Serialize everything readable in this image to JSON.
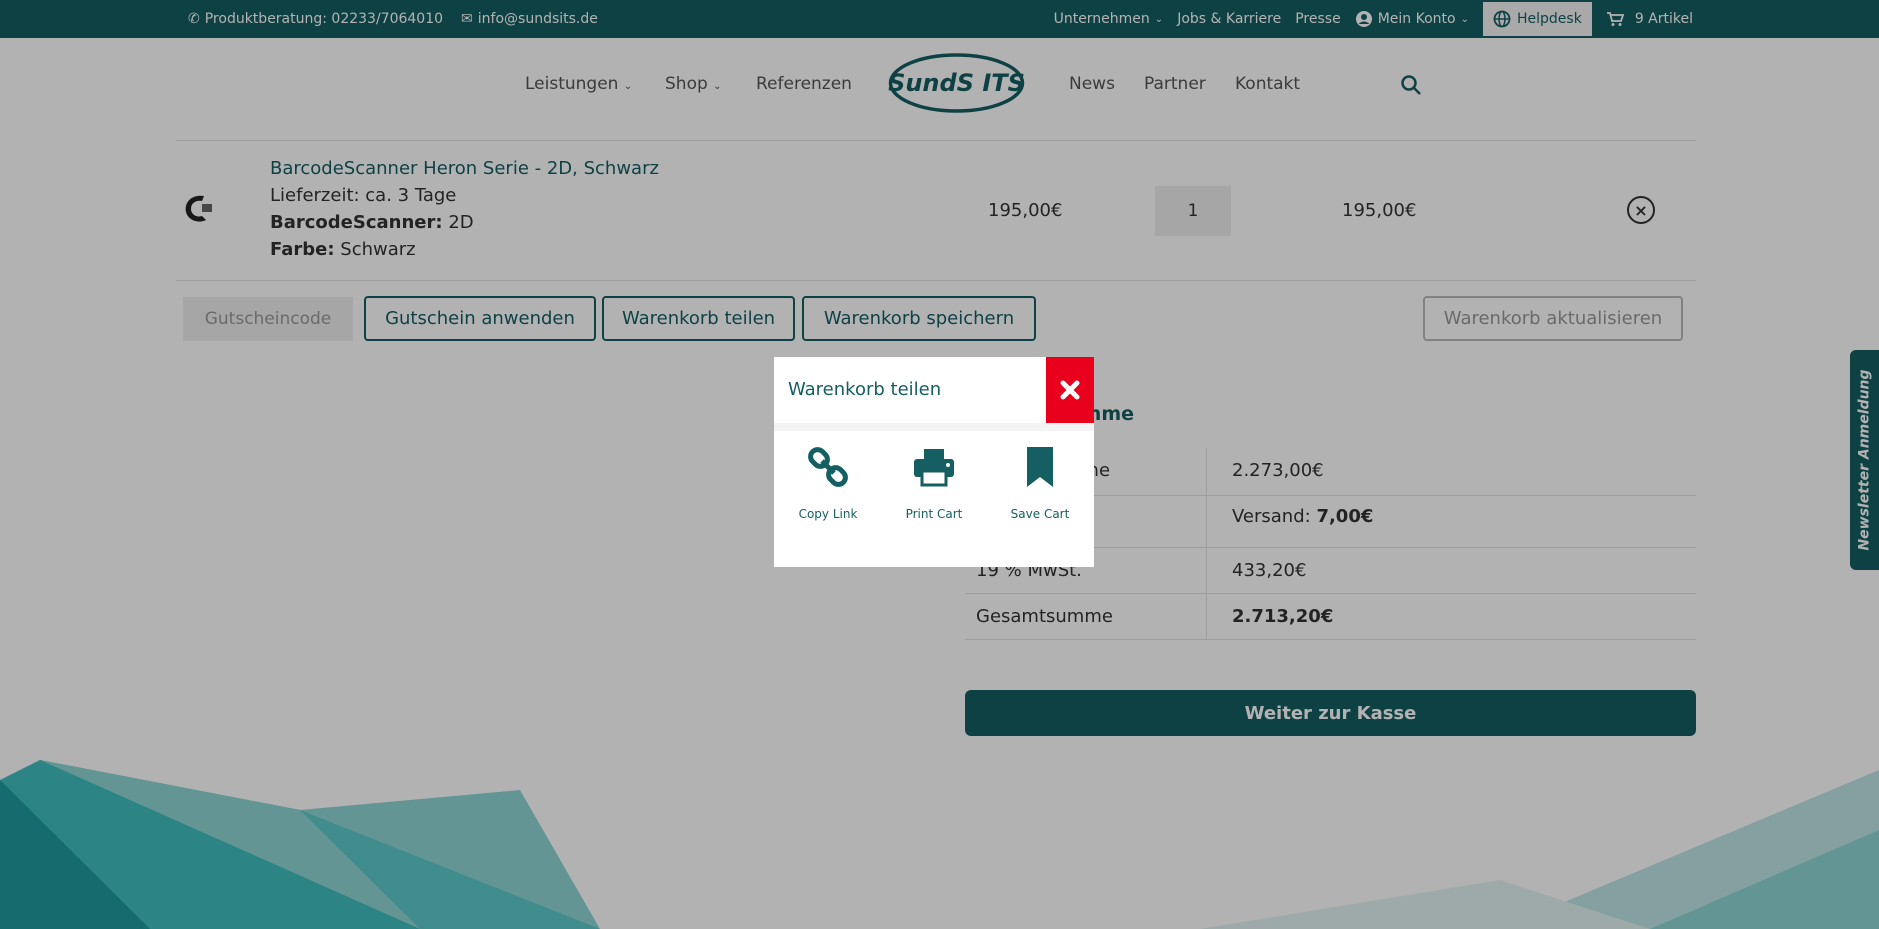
{
  "topbar": {
    "phone": "Produktberatung: 02233/7064010",
    "email": "info@sundsits.de",
    "company": "Unternehmen",
    "jobs": "Jobs & Karriere",
    "press": "Presse",
    "account": "Mein Konto",
    "helpdesk": "Helpdesk",
    "cart": "9 Artikel"
  },
  "nav": {
    "services": "Leistungen",
    "shop": "Shop",
    "references": "Referenzen",
    "logo_text": "SundS ITS",
    "news": "News",
    "partner": "Partner",
    "contact": "Kontakt"
  },
  "cart_item": {
    "name": "BarcodeScanner Heron Serie - 2D, Schwarz",
    "delivery": "Lieferzeit: ca. 3 Tage",
    "attr1_label": "BarcodeScanner:",
    "attr1_value": "2D",
    "attr2_label": "Farbe:",
    "attr2_value": "Schwarz",
    "price": "195,00€",
    "quantity": "1",
    "subtotal": "195,00€"
  },
  "actions": {
    "coupon_placeholder": "Gutscheincode",
    "apply_coupon": "Gutschein anwenden",
    "share_cart": "Warenkorb teilen",
    "save_cart": "Warenkorb speichern",
    "update_cart": "Warenkorb aktualisieren"
  },
  "totals": {
    "title_visible": "umme",
    "subtotal_label": "nme",
    "subtotal_value": "2.273,00€",
    "shipping_prefix": "Versand:",
    "shipping_value": "7,00€",
    "tax_label": "19 % MwSt.",
    "tax_value": "433,20€",
    "total_label": "Gesamtsumme",
    "total_value": "2.713,20€",
    "checkout": "Weiter zur Kasse"
  },
  "newsletter": "Newsletter Anmeldung",
  "modal": {
    "title": "Warenkorb teilen",
    "options": [
      {
        "label": "Copy Link",
        "icon": "link-icon"
      },
      {
        "label": "Print Cart",
        "icon": "print-icon"
      },
      {
        "label": "Save Cart",
        "icon": "bookmark-icon"
      }
    ]
  },
  "colors": {
    "brand": "#155e62",
    "close": "#e8001c"
  }
}
